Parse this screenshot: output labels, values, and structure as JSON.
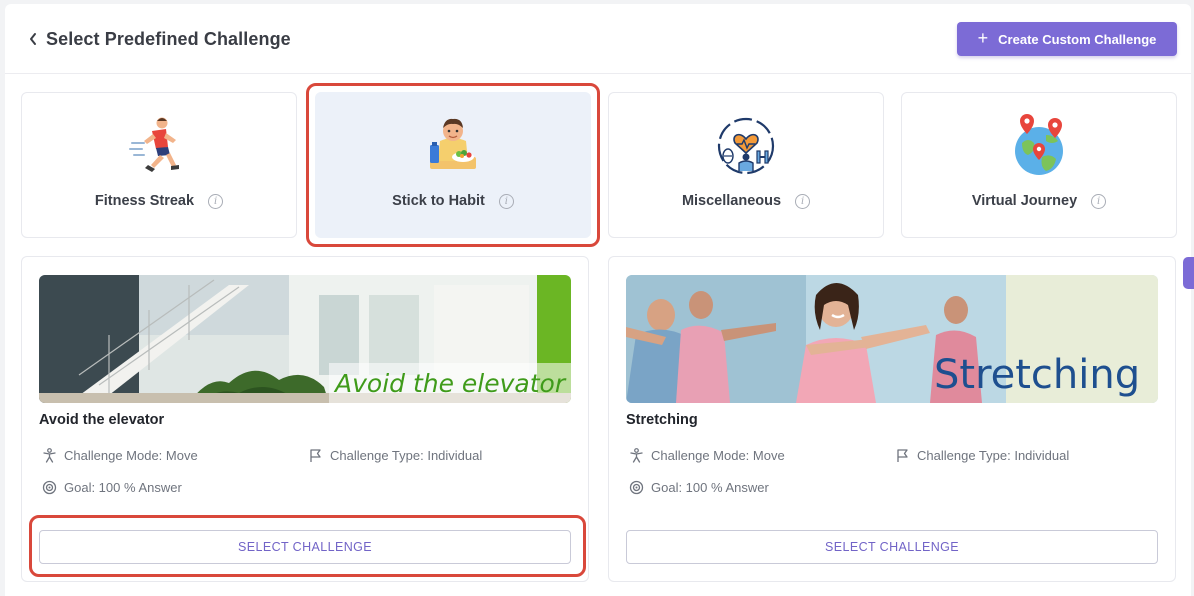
{
  "header": {
    "back_icon": "chevron-left-icon",
    "title": "Select Predefined Challenge",
    "create_button": {
      "icon": "plus-icon",
      "label": "Create Custom Challenge"
    }
  },
  "categories": [
    {
      "label": "Fitness Streak",
      "icon": "running-man-icon",
      "selected": false
    },
    {
      "label": "Stick to Habit",
      "icon": "habit-person-icon",
      "selected": true
    },
    {
      "label": "Miscellaneous",
      "icon": "health-fitness-icon",
      "selected": false
    },
    {
      "label": "Virtual Journey",
      "icon": "globe-pins-icon",
      "selected": false
    }
  ],
  "challenges": [
    {
      "title": "Avoid the elevator",
      "banner_text": "Avoid the elevator",
      "mode": "Challenge Mode: Move",
      "type": "Challenge Type: Individual",
      "goal": "Goal: 100 % Answer",
      "button": "SELECT CHALLENGE"
    },
    {
      "title": "Stretching",
      "banner_text": "Stretching",
      "mode": "Challenge Mode: Move",
      "type": "Challenge Type: Individual",
      "goal": "Goal: 100 % Answer",
      "button": "SELECT CHALLENGE"
    }
  ],
  "info_icon_glyph": "i",
  "colors": {
    "accent": "#7c6bd6",
    "highlight": "#d9483b",
    "selected_bg": "#ecf1f9"
  }
}
